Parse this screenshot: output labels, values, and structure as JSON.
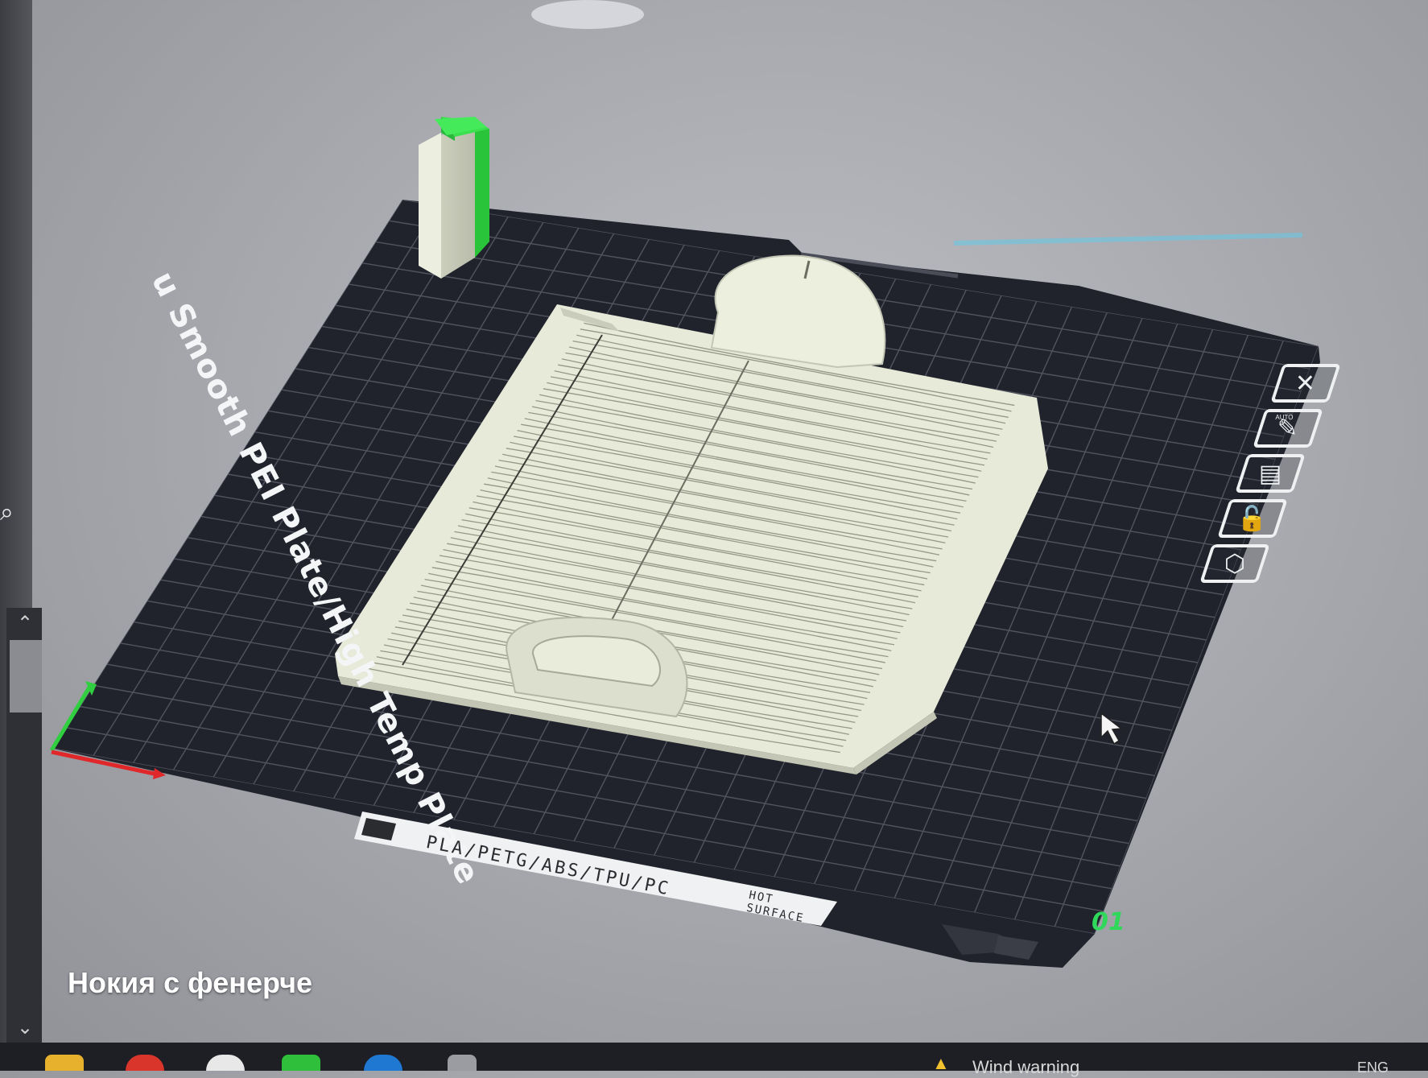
{
  "viewport": {
    "plate_label": "Smooth PEI Plate / High Temp Plate",
    "plate_label_display": "u Smooth PEI Plate/High Temp Plate",
    "strip_text": "PLA/PETG/ABS/TPU/PC",
    "hot_warning_line1": "HOT",
    "hot_warning_line2": "SURFACE",
    "plate_number": "01"
  },
  "side_toolbar": {
    "buttons": [
      {
        "name": "close-plate-icon",
        "glyph": "✕"
      },
      {
        "name": "auto-orient-icon",
        "glyph": "✎",
        "caption": "AUTO"
      },
      {
        "name": "arrange-icon",
        "glyph": "▤"
      },
      {
        "name": "lock-icon",
        "glyph": "🔓"
      },
      {
        "name": "plate-settings-icon",
        "glyph": "⬡"
      }
    ]
  },
  "left_panel": {
    "search_icon": "⌕",
    "scroll_up": "⌃",
    "scroll_down": "⌄"
  },
  "caption": "Нокия с фенерче",
  "taskbar": {
    "weather_text": "Wind warning",
    "language": "ENG"
  },
  "colors": {
    "plate": "#22242d",
    "grid": "#5c5f6b",
    "model": "#e6e9d9",
    "accent_green": "#2fd85a",
    "axis_red": "#e0282a"
  }
}
